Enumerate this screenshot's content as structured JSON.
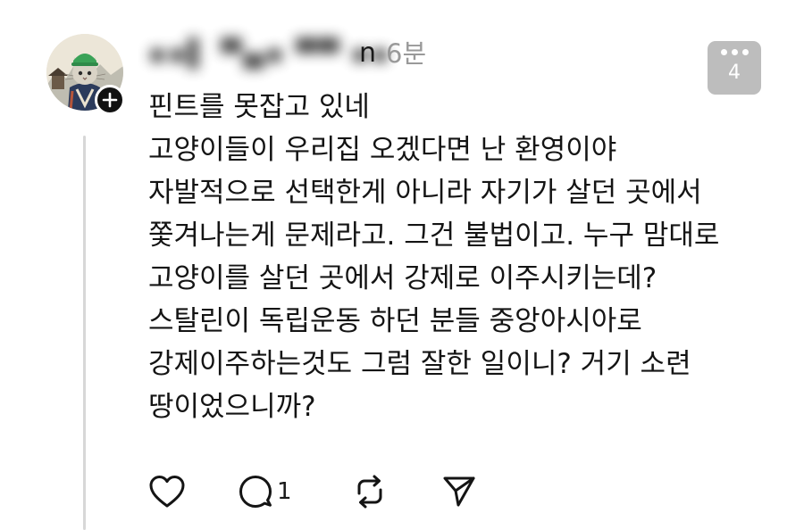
{
  "post": {
    "author_tail": "n",
    "timestamp": "6분",
    "more_count": "4",
    "lines": [
      "핀트를 못잡고 있네",
      "고양이들이 우리집 오겠다면 난 환영이야",
      "자발적으로 선택한게 아니라 자기가 살던 곳에서",
      "쫓겨나는게 문제라고. 그건 불법이고. 누구 맘대로",
      "고양이를 살던 곳에서 강제로 이주시키는데?",
      "스탈린이 독립운동 하던 분들 중앙아시아로",
      "강제이주하는것도 그럼 잘한 일이니? 거기 소련",
      "땅이었으니까?"
    ]
  },
  "actions": {
    "reply_count": "1"
  },
  "icons": {
    "avatar": "cat-in-hanbok-avatar",
    "follow": "plus-icon",
    "more": "more-dots-icon",
    "like": "heart-icon",
    "reply": "speech-bubble-icon",
    "repost": "repost-icon",
    "share": "send-icon"
  },
  "colors": {
    "text": "#141414",
    "muted": "#999999",
    "badge": "#bdbdbd",
    "thread_line": "#d7d7d7"
  }
}
